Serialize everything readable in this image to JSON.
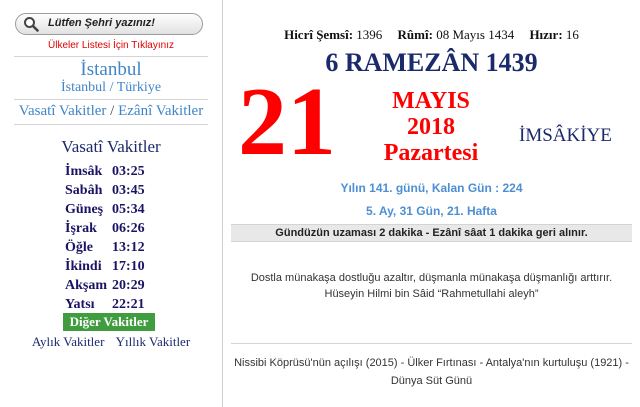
{
  "search": {
    "placeholder": "Lütfen Şehri yazınız!"
  },
  "country_link": "Ülkeler Listesi İçin Tıklayınız",
  "location": {
    "city": "İstanbul",
    "sub": "İstanbul / Türkiye"
  },
  "modes": {
    "vasati": "Vasatî Vakitler",
    "separator": "/",
    "ezani": "Ezânî Vakitler"
  },
  "times_title": "Vasatî Vakitler",
  "times": [
    {
      "name": "İmsâk",
      "time": "03:25"
    },
    {
      "name": "Sabâh",
      "time": "03:45"
    },
    {
      "name": "Güneş",
      "time": "05:34"
    },
    {
      "name": "İşrak",
      "time": "06:26"
    },
    {
      "name": "Öğle",
      "time": "13:12"
    },
    {
      "name": "İkindi",
      "time": "17:10"
    },
    {
      "name": "Akşam",
      "time": "20:29"
    },
    {
      "name": "Yatsı",
      "time": "22:21"
    }
  ],
  "other_times_button": "Diğer Vakitler",
  "monthly_link": "Aylık Vakitler",
  "yearly_link": "Yıllık Vakitler",
  "header": {
    "hijri_shamsi_label": "Hicrî Şemsî:",
    "hijri_shamsi_value": "1396",
    "rumi_label": "Rûmî:",
    "rumi_value": "08 Mayıs 1434",
    "hizir_label": "Hızır:",
    "hizir_value": "16"
  },
  "hijri_date": "6 RAMEZÂN 1439",
  "day": "21",
  "month": "MAYIS",
  "year": "2018",
  "weekday": "Pazartesi",
  "imsakiye": "İMSÂKİYE",
  "year_day_info": "Yılın 141. günü, Kalan Gün : 224",
  "week_info": "5. Ay, 31 Gün, 21. Hafta",
  "day_length_info": "Gündüzün uzaması 2 dakika - Ezânî sâat 1 dakika geri alınır.",
  "quote": {
    "text": "Dostla münakaşa dostluğu azaltır, düşmanla münakaşa düşmanlığı arttırır.",
    "author": "Hüseyin Hilmi bin Sâid “Rahmetullahi aleyh”"
  },
  "events": "Nissibi Köprüsü'nün açılışı (2015) - Ülker Fırtınası - Antalya'nın kurtuluşu (1921) - Dünya Süt Günü",
  "colors": {
    "accent_blue": "#3f86c8",
    "navy": "#1b2a6b",
    "red": "#ff0000",
    "green": "#3f9c3f"
  }
}
